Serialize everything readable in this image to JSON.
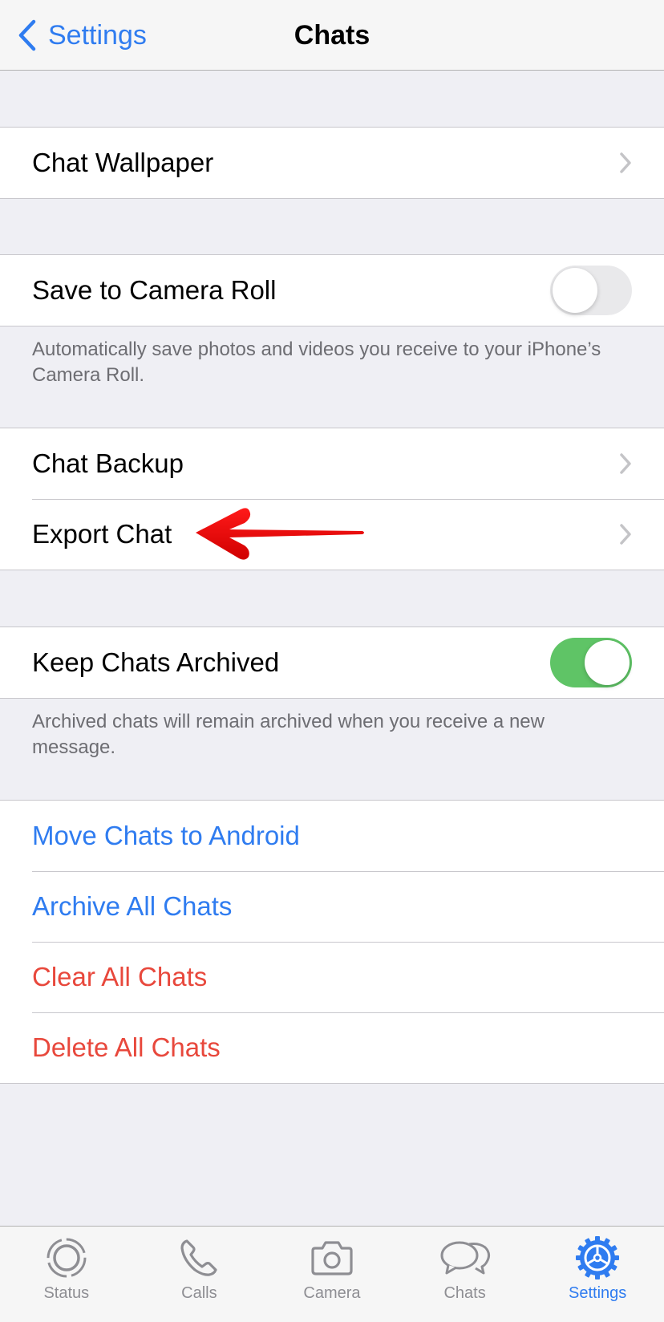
{
  "navbar": {
    "back_label": "Settings",
    "title": "Chats"
  },
  "sections": {
    "wallpaper": {
      "label": "Chat Wallpaper"
    },
    "camera_roll": {
      "label": "Save to Camera Roll",
      "enabled": false,
      "footer": "Automatically save photos and videos you receive to your iPhone’s Camera Roll."
    },
    "backup": {
      "label": "Chat Backup"
    },
    "export": {
      "label": "Export Chat"
    },
    "archived": {
      "label": "Keep Chats Archived",
      "enabled": true,
      "footer": "Archived chats will remain archived when you receive a new message."
    },
    "actions": [
      {
        "label": "Move Chats to Android",
        "style": "blue"
      },
      {
        "label": "Archive All Chats",
        "style": "blue"
      },
      {
        "label": "Clear All Chats",
        "style": "red"
      },
      {
        "label": "Delete All Chats",
        "style": "red"
      }
    ]
  },
  "annotation": {
    "icon": "red-arrow-icon",
    "points_to": "Export Chat",
    "color": "#e8000b"
  },
  "tabbar": {
    "active": "Settings",
    "items": [
      {
        "label": "Status",
        "icon": "status-icon"
      },
      {
        "label": "Calls",
        "icon": "phone-icon"
      },
      {
        "label": "Camera",
        "icon": "camera-icon"
      },
      {
        "label": "Chats",
        "icon": "chat-bubbles-icon"
      },
      {
        "label": "Settings",
        "icon": "gear-icon"
      }
    ]
  },
  "colors": {
    "accent_blue": "#2f7cf0",
    "destructive_red": "#e8483c",
    "toggle_on": "#5fc466",
    "background": "#efeff4"
  }
}
